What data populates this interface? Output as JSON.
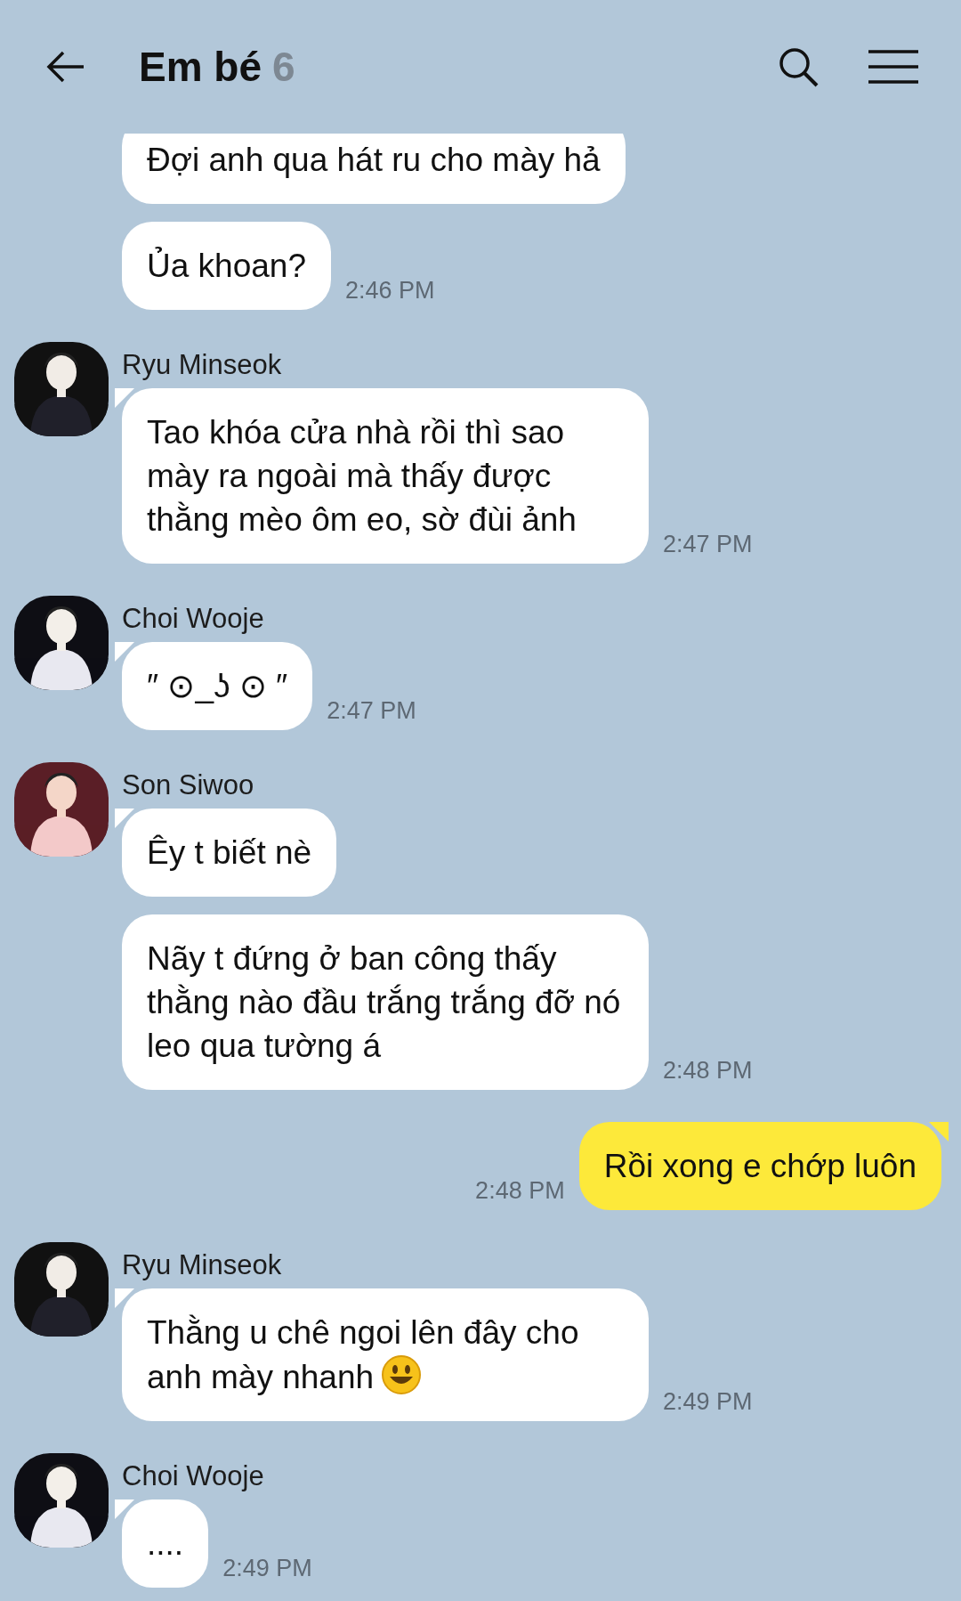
{
  "header": {
    "title": "Em bé",
    "member_count": "6"
  },
  "groups": [
    {
      "kind": "received",
      "messages": [
        {
          "text": "Đợi anh qua hát ru cho mày hả"
        },
        {
          "text": "Ủa khoan?",
          "time": "2:46 PM"
        }
      ]
    },
    {
      "kind": "received",
      "sender": "Ryu Minseok",
      "messages": [
        {
          "text": "Tao khóa cửa nhà rồi thì sao mày ra ngoài mà thấy được thằng mèo ôm eo, sờ đùi ảnh",
          "time": "2:47 PM"
        }
      ]
    },
    {
      "kind": "received",
      "sender": "Choi Wooje",
      "messages": [
        {
          "text": "″ ⊙_ʖ ⊙ ″",
          "time": "2:47 PM"
        }
      ]
    },
    {
      "kind": "received",
      "sender": "Son Siwoo",
      "messages": [
        {
          "text": "Êy t biết nè"
        },
        {
          "text": "Nãy t đứng ở ban công thấy thằng nào đầu trắng trắng đỡ nó leo qua tường á",
          "time": "2:48 PM"
        }
      ]
    },
    {
      "kind": "sent",
      "messages": [
        {
          "text": "Rồi xong e chớp luôn",
          "time": "2:48 PM"
        }
      ]
    },
    {
      "kind": "received",
      "sender": "Ryu Minseok",
      "messages": [
        {
          "text": "Thằng u chê ngoi lên đây cho anh mày nhanh",
          "emoji": true,
          "time": "2:49 PM"
        }
      ]
    },
    {
      "kind": "received",
      "sender": "Choi Wooje",
      "messages": [
        {
          "text": "....",
          "time": "2:49 PM"
        }
      ]
    }
  ]
}
